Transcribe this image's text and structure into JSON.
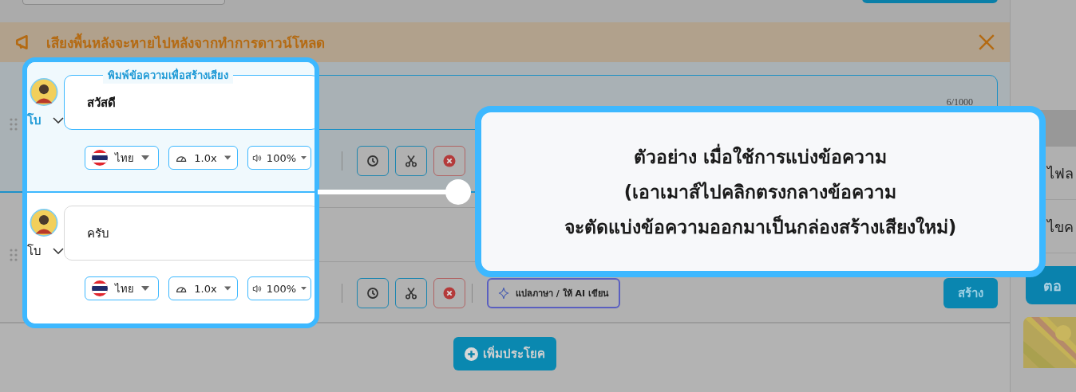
{
  "banner": {
    "text": "เสียงพื้นหลังจะหายไปหลังจากทำการดาวน์โหลด"
  },
  "sentences": [
    {
      "active": true,
      "voice": "โบ",
      "label": "พิมพ์ข้อความเพื่อสร้างเสียง",
      "value": "สวัสดี",
      "counter": "6/1000",
      "language": "ไทย",
      "speed": "1.0x",
      "volume": "100%"
    },
    {
      "active": false,
      "voice": "โบ",
      "value": "ครับ",
      "language": "ไทย",
      "speed": "1.0x",
      "volume": "100%",
      "ai_button": "แปลภาษา / ให้ AI เขียน",
      "create_button": "สร้าง"
    }
  ],
  "add_button": "เพิ่มประโยค",
  "tooltip": {
    "lines": [
      "ตัวอย่าง เมื่อใช้การแบ่งข้อความ",
      "(เอาเมาส์ไปคลิกตรงกลางข้อความ",
      "จะตัดแบ่งข้อความออกมาเป็นกล่องสร้างเสียงใหม่)"
    ]
  },
  "sidebar": {
    "items": [
      "ไฟล",
      "ไขค"
    ],
    "button": "ตอ"
  }
}
